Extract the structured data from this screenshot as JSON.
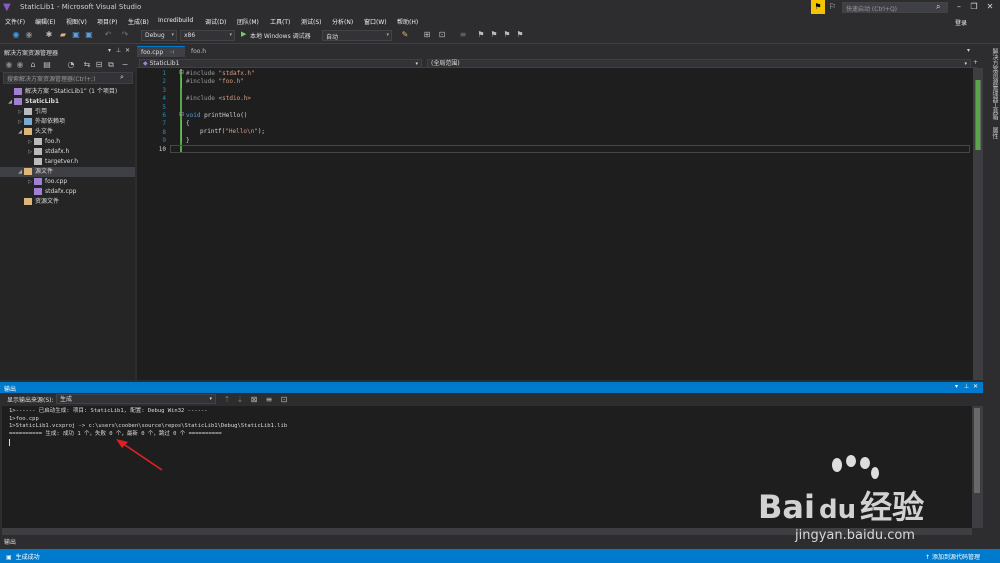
{
  "window": {
    "title": "StaticLib1 - Microsoft Visual Studio",
    "quick_launch_placeholder": "快速启动 (Ctrl+Q)",
    "login": "登录"
  },
  "menu": [
    "文件(F)",
    "编辑(E)",
    "视图(V)",
    "项目(P)",
    "生成(B)",
    "Incredibuild",
    "调试(D)",
    "团队(M)",
    "工具(T)",
    "测试(S)",
    "分析(N)",
    "窗口(W)",
    "帮助(H)"
  ],
  "toolbar": {
    "config": "Debug",
    "platform": "x86",
    "run_label": "本地 Windows 调试器",
    "run_mode": "自动"
  },
  "solution_explorer": {
    "title": "解决方案资源管理器",
    "search_placeholder": "搜索解决方案资源管理器(Ctrl+;)",
    "tree": [
      {
        "label": "解决方案 “StaticLib1” (1 个项目)",
        "level": 0,
        "expander": "",
        "icon": "solution-icon"
      },
      {
        "label": "StaticLib1",
        "level": 0,
        "expander": "◢",
        "icon": "project-icon",
        "bold": true
      },
      {
        "label": "引用",
        "level": 1,
        "expander": "▷",
        "icon": "references-icon"
      },
      {
        "label": "外部依赖项",
        "level": 1,
        "expander": "▷",
        "icon": "external-deps-icon"
      },
      {
        "label": "头文件",
        "level": 1,
        "expander": "◢",
        "icon": "folder-icon"
      },
      {
        "label": "foo.h",
        "level": 2,
        "expander": "▷",
        "icon": "header-file-icon"
      },
      {
        "label": "stdafx.h",
        "level": 2,
        "expander": "▷",
        "icon": "header-file-icon"
      },
      {
        "label": "targetver.h",
        "level": 2,
        "expander": "",
        "icon": "header-file-icon"
      },
      {
        "label": "源文件",
        "level": 1,
        "expander": "◢",
        "icon": "folder-icon",
        "selected": true
      },
      {
        "label": "foo.cpp",
        "level": 2,
        "expander": "▷",
        "icon": "cpp-file-icon"
      },
      {
        "label": "stdafx.cpp",
        "level": 2,
        "expander": "",
        "icon": "cpp-file-icon"
      },
      {
        "label": "资源文件",
        "level": 1,
        "expander": "",
        "icon": "folder-icon"
      }
    ]
  },
  "editor": {
    "tabs": [
      "foo.cpp",
      "foo.h"
    ],
    "nav_project": "StaticLib1",
    "nav_scope": "(全局范围)",
    "line_numbers": [
      "1",
      "2",
      "3",
      "4",
      "5",
      "6",
      "7",
      "8",
      "9",
      "10"
    ]
  },
  "code": {
    "l1_pp": "#include ",
    "l1_str": "\"stdafx.h\"",
    "l2_pp": "#include ",
    "l2_str": "\"foo.h\"",
    "l4_pp": "#include ",
    "l4_str": "<stdio.h>",
    "l6_kw": "void",
    "l6_rest": " printHello()",
    "l7": "{",
    "l8_a": "printf(",
    "l8_str": "\"Hello\\n\"",
    "l8_b": ");",
    "l9": "}"
  },
  "output": {
    "title": "输出",
    "source_label": "显示输出来源(S):",
    "source_value": "生成",
    "lines": [
      "1>------ 已启动生成: 项目: StaticLib1, 配置: Debug Win32 ------",
      "1>foo.cpp",
      "1>StaticLib1.vcxproj -> c:\\users\\cooben\\source\\repos\\StaticLib1\\Debug\\StaticLib1.lib",
      "========== 生成: 成功 1 个，失败 0 个，最新 0 个，跳过 0 个 =========="
    ],
    "bottom_tab": "输出"
  },
  "right_tabs": [
    "解决方案资源管理器",
    "工具箱",
    "属性"
  ],
  "status": {
    "left": "生成成功",
    "right": "添加到源代码管理"
  },
  "watermark": {
    "brand": "Bai",
    "brand2": "经验",
    "url": "jingyan.baidu.com"
  },
  "colors": {
    "accent": "#007acc",
    "annotation_arrow": "#e02020"
  }
}
